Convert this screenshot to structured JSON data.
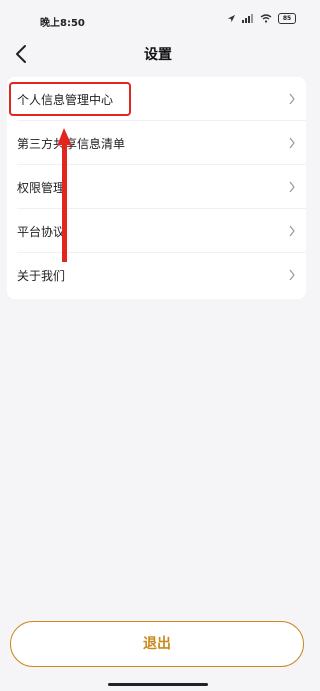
{
  "status_bar": {
    "time": "晚上8:50",
    "battery": "85"
  },
  "header": {
    "title": "设置"
  },
  "menu": {
    "items": [
      {
        "label": "个人信息管理中心"
      },
      {
        "label": "第三方共享信息清单"
      },
      {
        "label": "权限管理"
      },
      {
        "label": "平台协议"
      },
      {
        "label": "关于我们"
      }
    ]
  },
  "footer": {
    "logout_label": "退出"
  },
  "colors": {
    "accent": "#c98a1e",
    "highlight": "#e0261f",
    "background": "#f5f5f7"
  }
}
